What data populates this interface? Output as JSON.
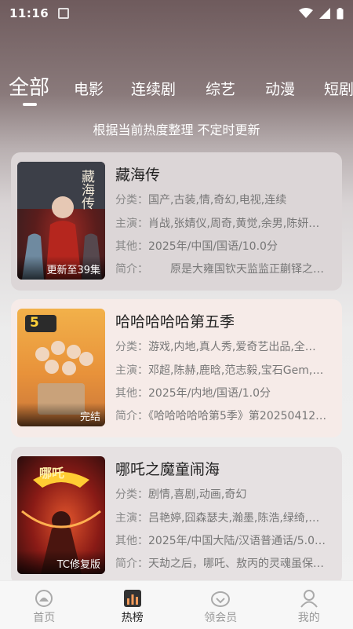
{
  "status_bar": {
    "time": "11:16"
  },
  "tabs": [
    {
      "label": "全部",
      "active": true
    },
    {
      "label": "电影"
    },
    {
      "label": "连续剧"
    },
    {
      "label": "综艺"
    },
    {
      "label": "动漫"
    },
    {
      "label": "短剧"
    }
  ],
  "subtitle": "根据当前热度整理 不定时更新",
  "cards": [
    {
      "title": "藏海传",
      "badge": "更新至39集",
      "poster_text": "藏海传",
      "category_label": "分类：",
      "category": "国产,古装,情,奇幻,电视,连续",
      "cast_label": "主演：",
      "cast": "肖战,张婧仪,周奇,黄觉,余男,陈妍…",
      "other_label": "其他：",
      "other": "2025年/中国/国语/10.0分",
      "intro_label": "简介：",
      "intro": "原是大雍国钦天监监正蒯铎之…"
    },
    {
      "title": "哈哈哈哈哈第五季",
      "badge": "完结",
      "poster_text": "5",
      "category_label": "分类：",
      "category": "游戏,内地,真人秀,爱奇艺出品,全…",
      "cast_label": "主演：",
      "cast": "邓超,陈赫,鹿晗,范志毅,宝石Gem,…",
      "other_label": "其他：",
      "other": "2025年/内地/国语/1.0分",
      "intro_label": "简介：",
      "intro": "《哈哈哈哈哈第5季》第20250412…"
    },
    {
      "title": "哪吒之魔童闹海",
      "badge": "TC修复版",
      "poster_text": "哪吒",
      "category_label": "分类：",
      "category": "剧情,喜剧,动画,奇幻",
      "cast_label": "主演：",
      "cast": "吕艳婷,囧森瑟夫,瀚墨,陈浩,绿绮,…",
      "other_label": "其他：",
      "other": "2025年/中国大陆/汉语普通话/5.0…",
      "intro_label": "简介：",
      "intro": "天劫之后，哪吒、敖丙的灵魂虽保…"
    }
  ],
  "bottom_nav": [
    {
      "label": "首页",
      "icon": "home-icon"
    },
    {
      "label": "热榜",
      "icon": "chart-icon",
      "active": true
    },
    {
      "label": "领会员",
      "icon": "vip-icon"
    },
    {
      "label": "我的",
      "icon": "profile-icon"
    }
  ]
}
